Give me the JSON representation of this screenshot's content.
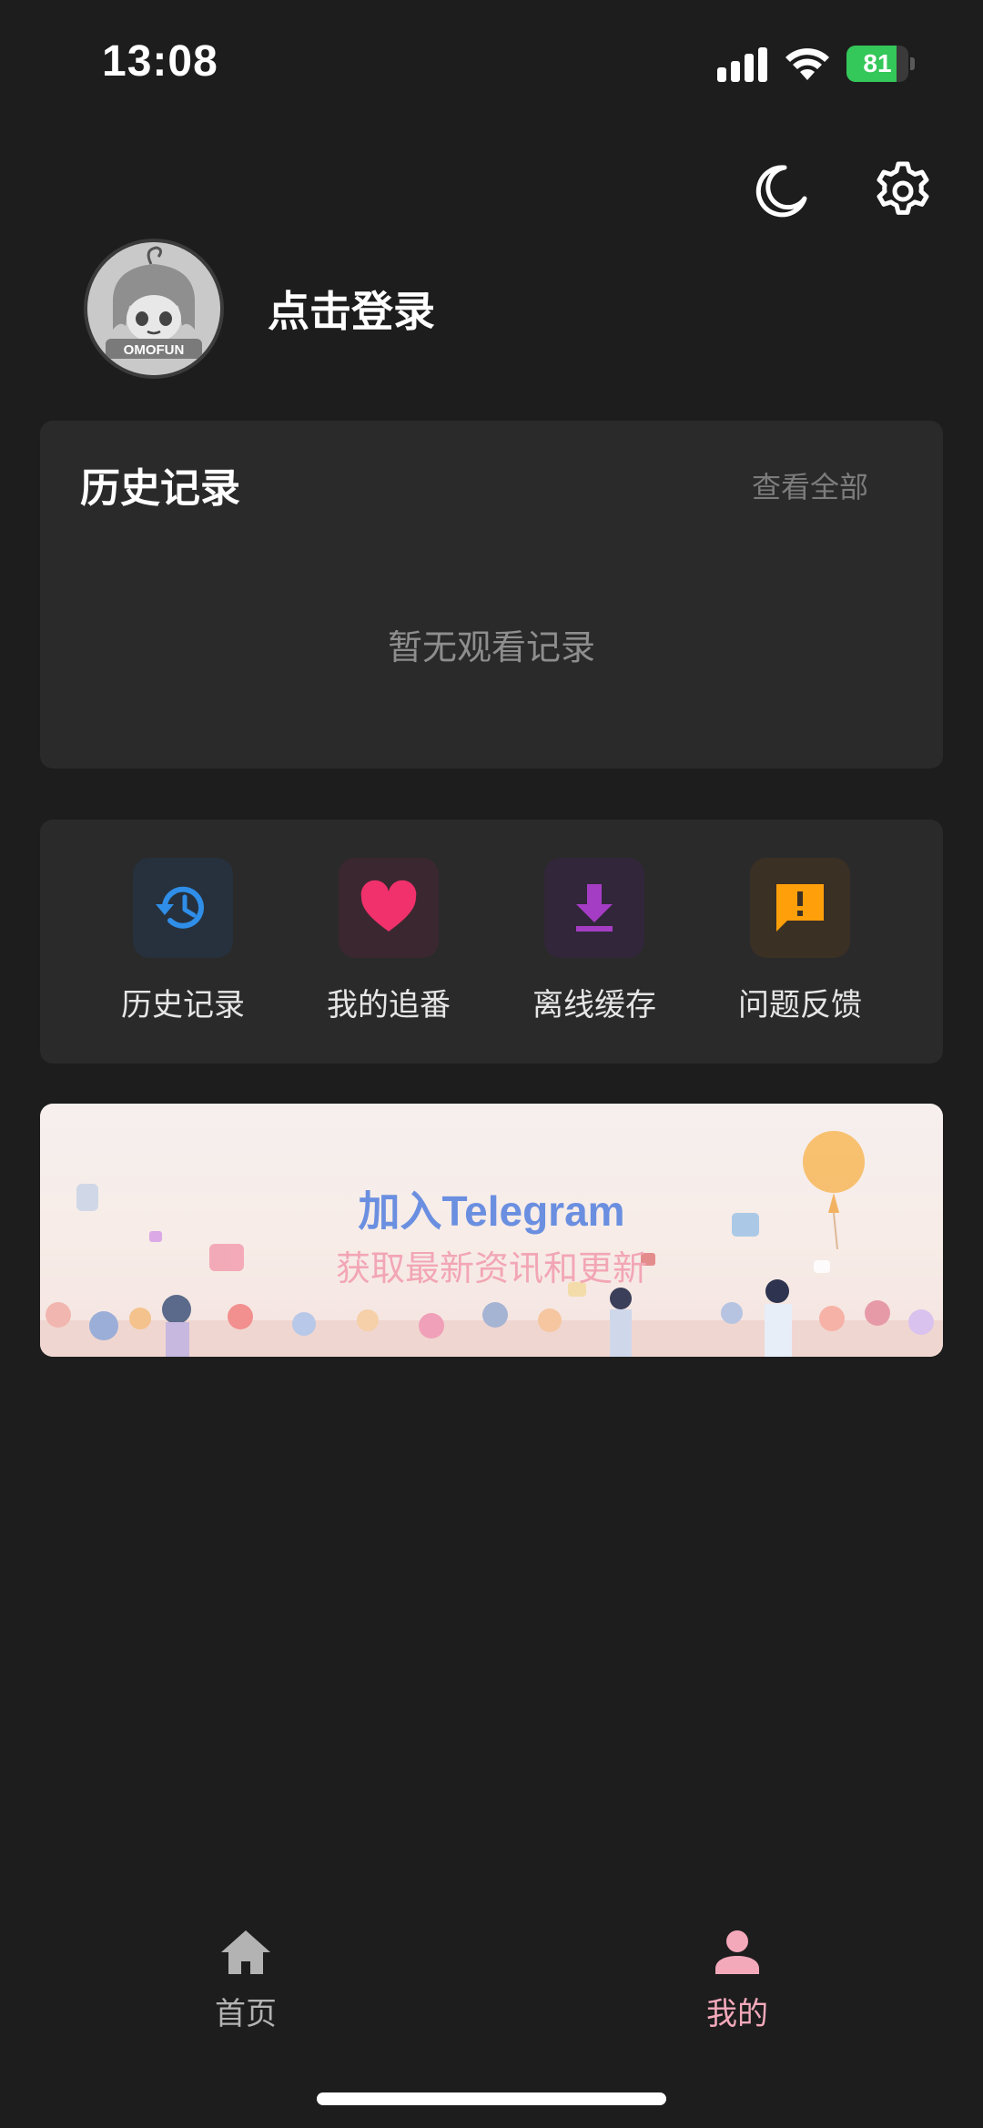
{
  "status_bar": {
    "time": "13:08",
    "battery_level": 81,
    "battery_label": "81"
  },
  "header": {
    "login_label": "点击登录",
    "avatar_logo": "OMOFUN"
  },
  "history": {
    "title": "历史记录",
    "view_all": "查看全部",
    "empty_text": "暂无观看记录"
  },
  "quick_actions": [
    {
      "label": "历史记录",
      "icon": "history-icon",
      "color": "#2f8ee8",
      "bg": "#26313d"
    },
    {
      "label": "我的追番",
      "icon": "heart-icon",
      "color": "#f0316b",
      "bg": "#3b2730"
    },
    {
      "label": "离线缓存",
      "icon": "download-icon",
      "color": "#a53dc4",
      "bg": "#32263a"
    },
    {
      "label": "问题反馈",
      "icon": "feedback-icon",
      "color": "#ff9f0a",
      "bg": "#3b3024"
    }
  ],
  "banner": {
    "title": "加入Telegram",
    "subtitle": "获取最新资讯和更新"
  },
  "tab_bar": {
    "tabs": [
      {
        "label": "首页",
        "icon": "home-icon",
        "active": false
      },
      {
        "label": "我的",
        "icon": "person-icon",
        "active": true
      }
    ],
    "active_color": "#f4a9bb",
    "inactive_color": "#b3b3b3"
  }
}
